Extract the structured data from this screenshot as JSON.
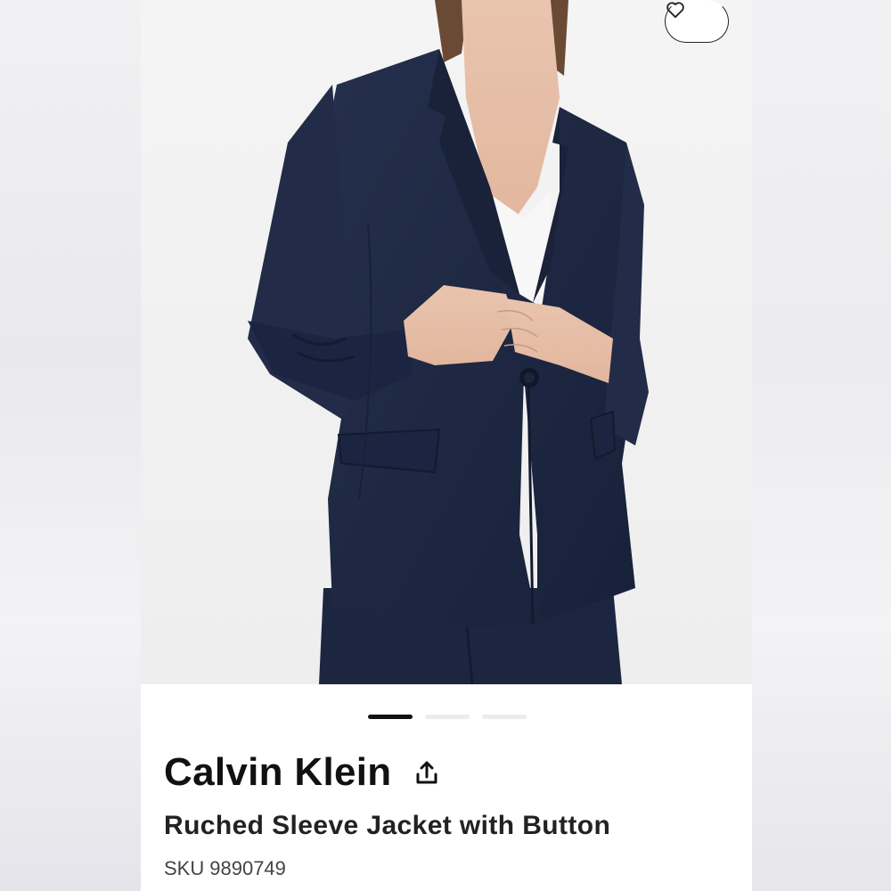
{
  "product": {
    "brand": "Calvin Klein",
    "name": "Ruched Sleeve Jacket with Button",
    "sku_label": "SKU",
    "sku_value": "9890749"
  },
  "gallery": {
    "image_count": 3,
    "active_index": 0,
    "image_subject": "model wearing navy ruched sleeve blazer with white v-neck top"
  },
  "icons": {
    "favorite": "heart-icon",
    "share": "share-icon"
  },
  "colors": {
    "jacket": "#1f2a44",
    "text_primary": "#111111",
    "indicator_active": "#111111",
    "indicator_inactive": "#ececec"
  }
}
